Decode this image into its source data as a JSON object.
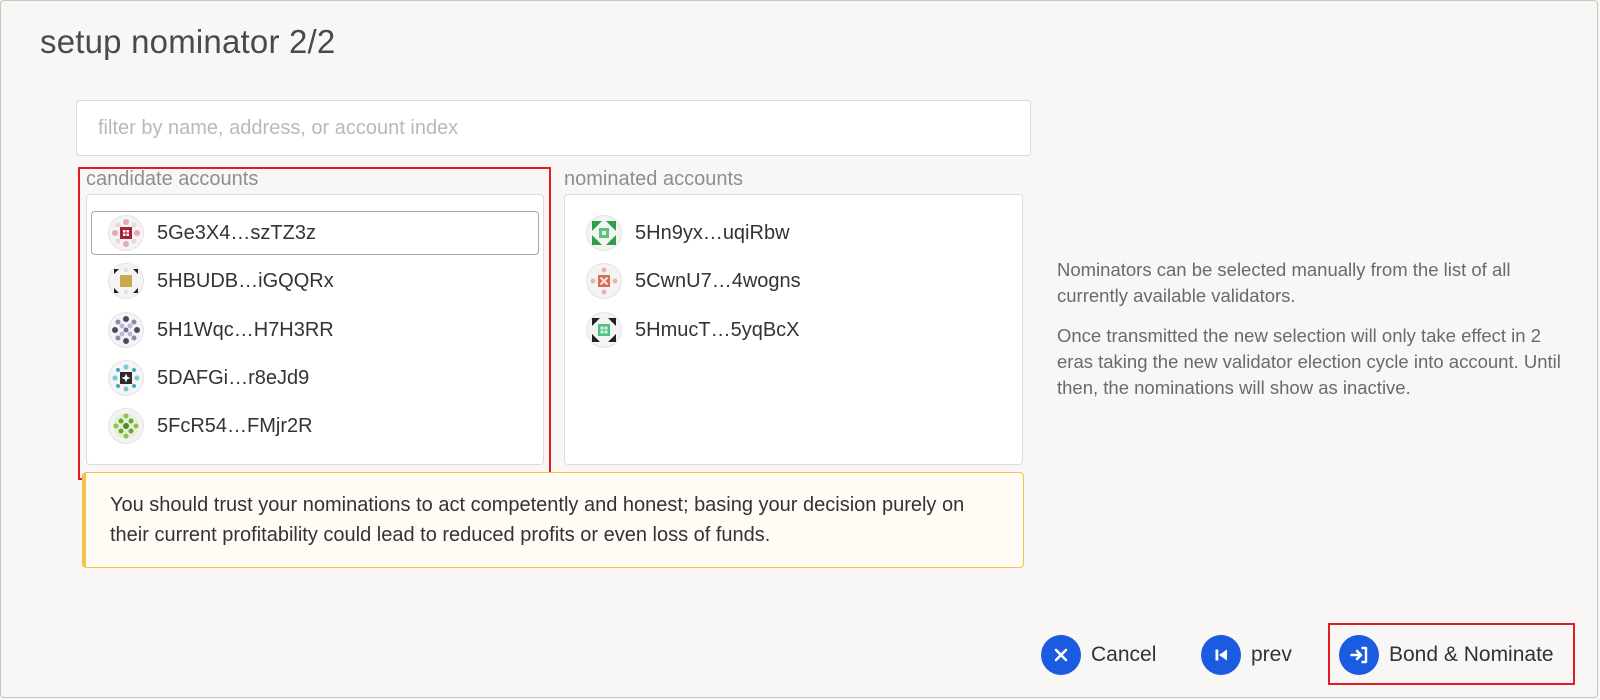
{
  "modal": {
    "title": "setup nominator 2/2"
  },
  "filter": {
    "placeholder": "filter by name, address, or account index",
    "value": ""
  },
  "candidates": {
    "label": "candidate accounts",
    "items": [
      {
        "name": "5Ge3X4…szTZ3z",
        "selected": true
      },
      {
        "name": "5HBUDB…iGQQRx",
        "selected": false
      },
      {
        "name": "5H1Wqc…H7H3RR",
        "selected": false
      },
      {
        "name": "5DAFGi…r8eJd9",
        "selected": false
      },
      {
        "name": "5FcR54…FMjr2R",
        "selected": false
      }
    ]
  },
  "nominated": {
    "label": "nominated accounts",
    "items": [
      {
        "name": "5Hn9yx…uqiRbw"
      },
      {
        "name": "5CwnU7…4wogns"
      },
      {
        "name": "5HmucT…5yqBcX"
      }
    ]
  },
  "warning": {
    "text": "You should trust your nominations to act competently and honest; basing your decision purely on their current profitability could lead to reduced profits or even loss of funds."
  },
  "help": {
    "paragraph1": "Nominators can be selected manually from the list of all currently available validators.",
    "paragraph2": "Once transmitted the new selection will only take effect in 2 eras taking the new validator election cycle into account. Until then, the nominations will show as inactive."
  },
  "actions": {
    "cancel_label": "Cancel",
    "prev_label": "prev",
    "submit_label": "Bond & Nominate"
  },
  "colors": {
    "accent": "#1a5be0",
    "highlight": "#e31b23",
    "warning_border": "#f5c34b"
  }
}
